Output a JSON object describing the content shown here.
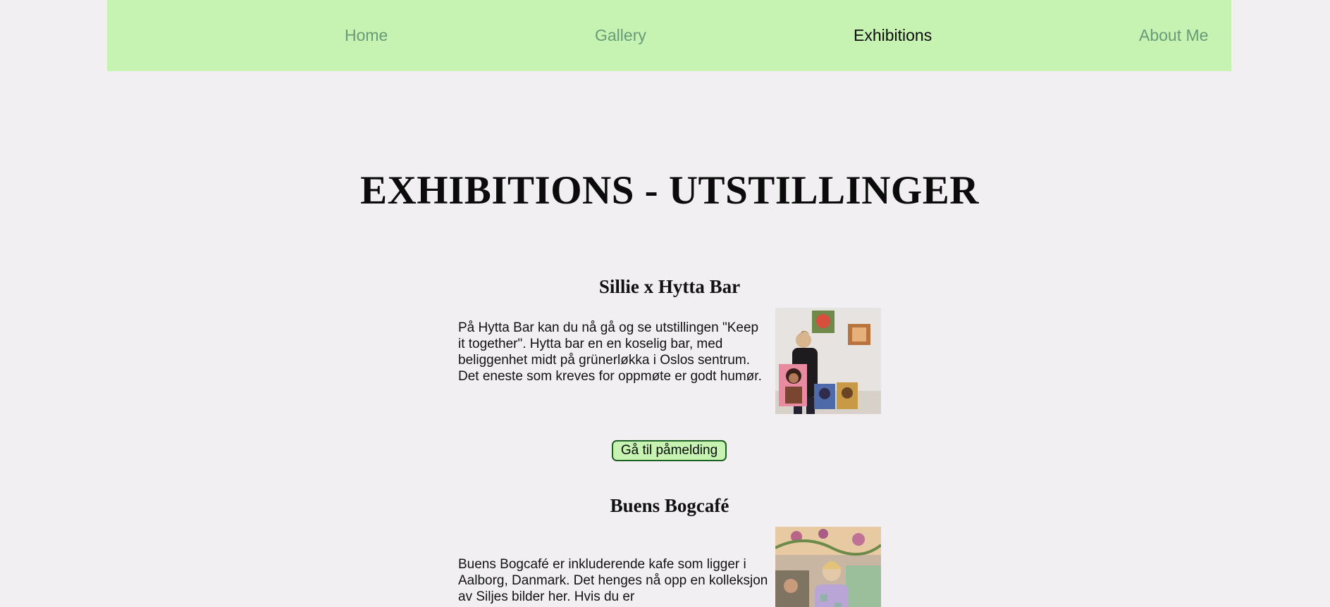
{
  "nav": {
    "home": "Home",
    "gallery": "Gallery",
    "exhibitions": "Exhibitions",
    "about": "About Me"
  },
  "page": {
    "title": "EXHIBITIONS - UTSTILLINGER"
  },
  "exhibitions": [
    {
      "title": "Sillie x Hytta Bar",
      "description": "På Hytta Bar kan du nå gå og se utstillingen \"Keep it together\". Hytta bar en en koselig bar, med beliggenhet midt på grünerløkka i Oslos sentrum. Det eneste som kreves for oppmøte er godt humør.",
      "button": "Gå til påmelding"
    },
    {
      "title": "Buens Bogcafé",
      "description": "Buens Bogcafé er inkluderende kafe som ligger i Aalborg, Danmark. Det henges nå opp en kolleksjon av Siljes bilder her. Hvis du er"
    }
  ],
  "colors": {
    "nav_background": "#c6f3b2",
    "nav_link": "#6a9a77",
    "nav_active": "#0c0c0c",
    "page_background": "#f1eff2",
    "button_border": "#1e5f22"
  }
}
